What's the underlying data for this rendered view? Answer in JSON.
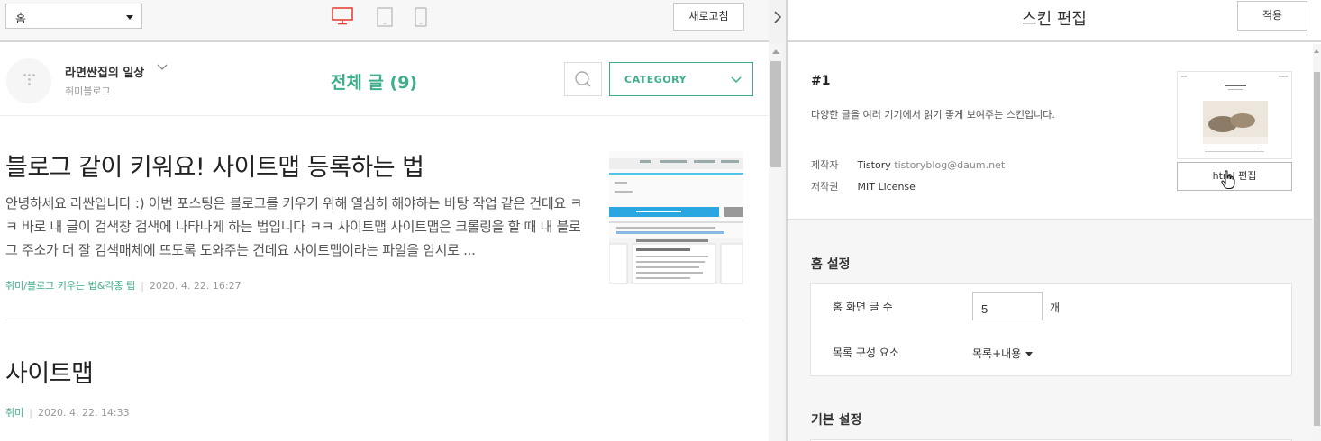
{
  "left_toolbar": {
    "page_select": "홈",
    "refresh_label": "새로고침"
  },
  "blog": {
    "name": "라면싼집의 일상",
    "subtitle": "취미블로그",
    "list_title": "전체 글 (9)",
    "category_label": "CATEGORY"
  },
  "posts": [
    {
      "title": "블로그 같이 키워요! 사이트맵 등록하는 법",
      "excerpt": "안녕하세요 라싼입니다 :) 이번 포스팅은 블로그를 키우기 위해 열심히 해야하는 바탕 작업 같은 건데요 ㅋㅋ 바로 내 글이 검색창 검색에 나타나게 하는 법입니다 ㅋㅋ 사이트맵 사이트맵은 크롤링을 할 때 내 블로그 주소가 더 잘 검색매체에 뜨도록 도와주는 건데요 사이트맵이라는 파일을 임시로 ...",
      "category": "취미/블로그 키우는 법&각종 팁",
      "date": "2020. 4. 22. 16:27"
    },
    {
      "title": "사이트맵",
      "category": "취미",
      "date": "2020. 4. 22. 14:33"
    }
  ],
  "right_panel": {
    "title": "스킨 편집",
    "apply_label": "적용",
    "skin": {
      "number": "#1",
      "description": "다양한 글을 여러 기기에서 읽기 좋게 보여주는 스킨입니다.",
      "author_key": "제작자",
      "author_name": "Tistory",
      "author_email": "tistoryblog@daum.net",
      "license_key": "저작권",
      "license_value": "MIT License",
      "html_edit_label": "html 편집"
    },
    "home_settings": {
      "title": "홈 설정",
      "post_count_label": "홈 화면 글 수",
      "post_count_value": "5",
      "post_count_unit": "개",
      "list_component_label": "목록 구성 요소",
      "list_component_value": "목록+내용"
    },
    "basic_settings": {
      "title": "기본 설정"
    }
  },
  "colors": {
    "accent": "#3eae8c",
    "desktop_icon": "#e0392b"
  }
}
